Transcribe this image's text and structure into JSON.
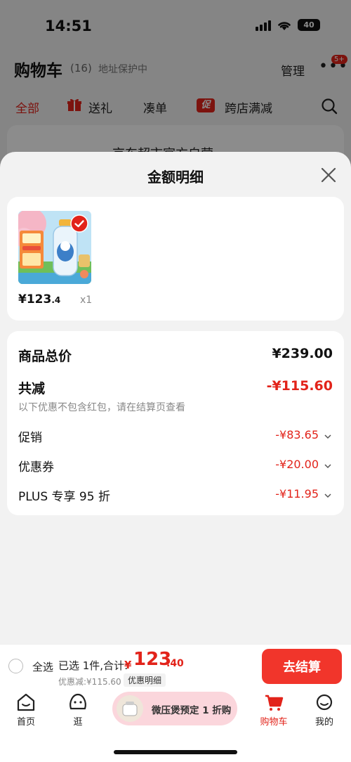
{
  "status_bar": {
    "time": "14:51",
    "battery": "40"
  },
  "cart_header": {
    "title": "购物车",
    "count": "(16)",
    "address_protect": "地址保护中",
    "manage": "管理",
    "more": "•••",
    "badge": "5+"
  },
  "filter_tabs": [
    "全部",
    "送礼",
    "凑单",
    "跨店满减"
  ],
  "promo_badge": "促",
  "shop": {
    "name": "京东超市官方自营"
  },
  "sheet": {
    "title": "金额明细",
    "product": {
      "price_symbol": "¥",
      "price_int": "123",
      "price_dec": ".4",
      "qty": "x1"
    },
    "summary": {
      "total_label": "商品总价",
      "total_value": "¥239.00",
      "reduce_label": "共减",
      "reduce_value": "-¥115.60",
      "note": "以下优惠不包含红包，请在结算页查看",
      "items": [
        {
          "label": "促销",
          "value": "-¥83.65"
        },
        {
          "label": "优惠券",
          "value": "-¥20.00"
        },
        {
          "label": "PLUS 专享 95 折",
          "value": "-¥11.95"
        }
      ]
    }
  },
  "checkout": {
    "select_all": "全选",
    "selected": "已选 1件,合计:",
    "total_yen": "¥",
    "total_int": "123",
    "total_dec": ".40",
    "discount": "优惠减:¥115.60",
    "detail_link": "优惠明细",
    "button": "去结算"
  },
  "tab_bar": {
    "home": "首页",
    "browse": "逛",
    "promo": "微压煲预定 1 折购",
    "cart": "购物车",
    "mine": "我的"
  },
  "colors": {
    "accent": "#e2231a",
    "checkout_button": "#f1352b"
  }
}
